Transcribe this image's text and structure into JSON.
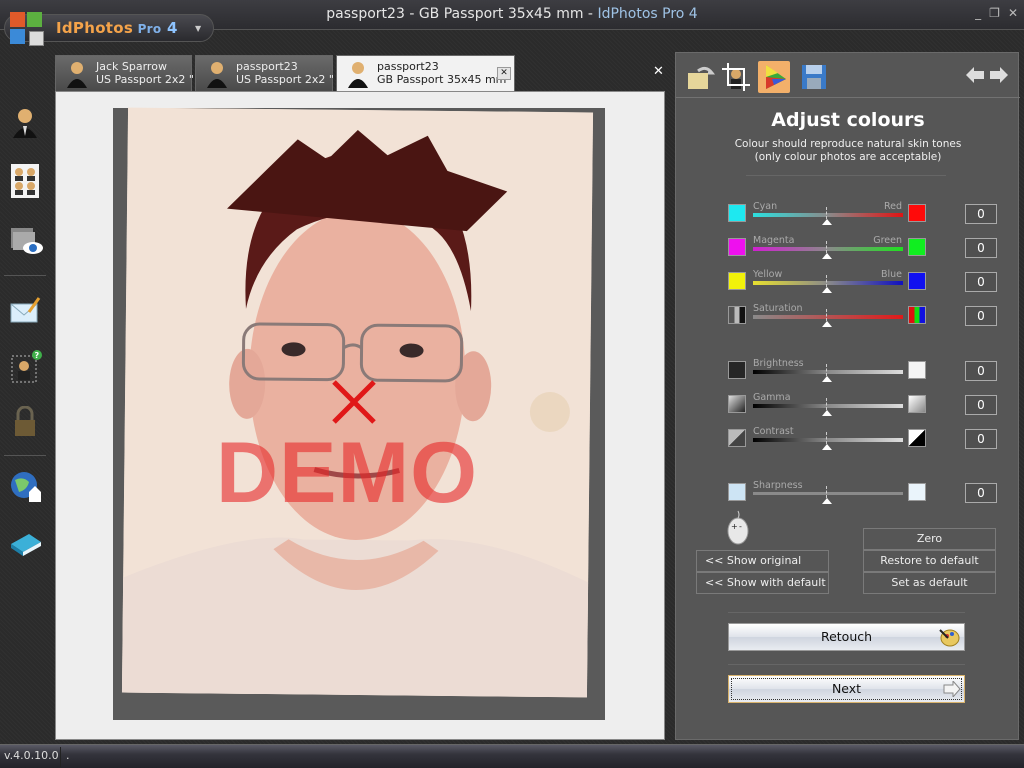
{
  "window": {
    "title_doc": "passport23 - GB Passport 35x45 mm - ",
    "title_app": "IdPhotos Pro 4",
    "controls": {
      "minimize": "_",
      "restore": "❐",
      "close": "✕"
    }
  },
  "logo": {
    "name": "IdPhotos",
    "pro": " Pro",
    "version": "4",
    "menu_caret": "▼"
  },
  "sidebar": {
    "items": [
      {
        "name": "person-icon",
        "label": "Person"
      },
      {
        "name": "photo-sheet-icon",
        "label": "Photo sheet"
      },
      {
        "name": "folder-view-icon",
        "label": "View folder"
      },
      {
        "name": "email-icon",
        "label": "Email"
      },
      {
        "name": "help-size-icon",
        "label": "Size help"
      },
      {
        "name": "lock-icon",
        "label": "Lock"
      },
      {
        "name": "web-home-icon",
        "label": "Website"
      },
      {
        "name": "manual-book-icon",
        "label": "Manual"
      }
    ]
  },
  "tabs": [
    {
      "line1": "Jack Sparrow",
      "line2": "US Passport 2x2 \"",
      "active": false
    },
    {
      "line1": "passport23",
      "line2": "US Passport 2x2 \"",
      "active": false
    },
    {
      "line1": "passport23",
      "line2": "GB Passport 35x45 mm",
      "active": true
    }
  ],
  "tab_close": "✕",
  "close_all": "✕",
  "preview": {
    "watermark": "DEMO"
  },
  "panel": {
    "tools": [
      "open-icon",
      "crop-icon",
      "colour-icon",
      "save-icon"
    ],
    "title": "Adjust colours",
    "subtitle1": "Colour should reproduce natural skin tones",
    "subtitle2": "(only colour photos are acceptable)",
    "sliders": [
      {
        "label": "Cyan",
        "right_label": "Red",
        "value": "0",
        "left_color": "#1ee8f0",
        "right_color": "#ff0a0a"
      },
      {
        "label": "Magenta",
        "right_label": "Green",
        "value": "0",
        "left_color": "#ee10ee",
        "right_color": "#10ee20"
      },
      {
        "label": "Yellow",
        "right_label": "Blue",
        "value": "0",
        "left_color": "#f2f20a",
        "right_color": "#1010f0"
      },
      {
        "label": "Saturation",
        "right_label": "",
        "value": "0"
      },
      {
        "label": "Brightness",
        "right_label": "",
        "value": "0"
      },
      {
        "label": "Gamma",
        "right_label": "",
        "value": "0"
      },
      {
        "label": "Contrast",
        "right_label": "",
        "value": "0"
      },
      {
        "label": "Sharpness",
        "right_label": "",
        "value": "0"
      }
    ],
    "buttons": {
      "show_original": "<<  Show original",
      "show_with_default": "<<  Show with default",
      "zero": "Zero",
      "restore_default": "Restore to default",
      "set_default": "Set as default",
      "retouch": "Retouch",
      "next": "Next"
    }
  },
  "status": {
    "version": "v.4.0.10.0",
    "text": "."
  }
}
